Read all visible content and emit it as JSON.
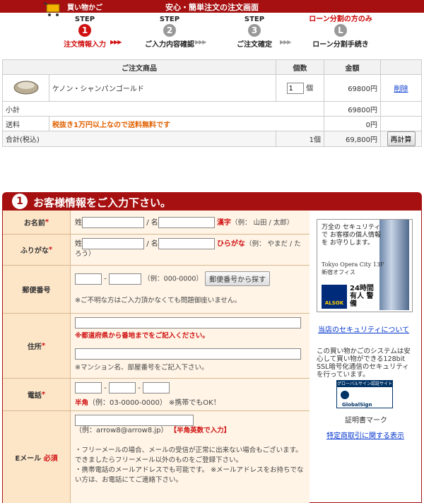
{
  "header": {
    "cart_label": "買い物かご",
    "title": "安心・簡単注文の注文画面"
  },
  "steps": [
    {
      "label": "STEP",
      "num": "1",
      "caption": "注文情報入力"
    },
    {
      "label": "STEP",
      "num": "2",
      "caption": "ご入力内容確認"
    },
    {
      "label": "STEP",
      "num": "3",
      "caption": "ご注文確定"
    },
    {
      "label": "ローン分割の方のみ",
      "num": "L",
      "caption": "ローン分割手続き"
    }
  ],
  "arrow_glyph": "▶▶▶",
  "cart": {
    "headers": [
      "ご注文商品",
      "個数",
      "金額"
    ],
    "item": {
      "name": "ケノン・シャンパンゴールド",
      "qty": "1",
      "qty_unit": "個",
      "price": "69800円",
      "delete": "削除"
    },
    "subtotal_label": "小計",
    "subtotal": "69800円",
    "shipping_label": "送料",
    "shipping_note": "税抜き1万円以上なので送料無料です",
    "shipping": "0円",
    "total_label": "合計(税込)",
    "total_qty": "1個",
    "total": "69,800円",
    "recalc": "再計算"
  },
  "section": {
    "num": "1",
    "title": "お客様情報をご入力下さい。"
  },
  "form": {
    "name": {
      "label": "お名前",
      "req": "*",
      "sei": "姓",
      "sep": "/ 名",
      "kind": "漢字",
      "example": "（例： 山田 / 太郎）"
    },
    "kana": {
      "label": "ふりがな",
      "req": "*",
      "sei": "姓",
      "sep": "/ 名",
      "kind": "ひらがな",
      "example": "（例： やまだ / たろう）"
    },
    "zip": {
      "label": "郵便番号",
      "dash": "-",
      "example": "（例：000-0000）",
      "button": "郵便番号から探す",
      "note": "※ご不明な方はご入力頂かなくても問題御座いません。"
    },
    "address": {
      "label": "住所",
      "req": "*",
      "note1": "※都道府県から番地までをご記入ください。",
      "note2": "※マンション名、部屋番号をご記入下さい。"
    },
    "tel": {
      "label": "電話",
      "req": "*",
      "dash": "-",
      "kind": "半角",
      "example": "（例：03-0000-0000）",
      "note": "※携帯でもOK！"
    },
    "email": {
      "label": "Eメール",
      "req": "必須",
      "example": "（例：arrow8@arrow8.jp）",
      "kind": "【半角英数で入力】",
      "note1": "・フリーメールの場合、メールの受信が正常に出来ない場合もございます。 できましたらフリーメール以外のものをご登録下さい。",
      "note2": "・携帯電話のメールアドレスでも可能です。 ※メールアドレスをお持ちでない方は、お電話にてご連絡下さい。"
    }
  },
  "side": {
    "security_text": "万全の セキュリティで お客様の個人情報を お守りします。",
    "city_line1": "Tokyo Opera City 13F",
    "city_line2": "新宿オフィス",
    "alsok": "ALSOK",
    "guard": "24時間 有人 警備",
    "security_link": "当店のセキュリティについて",
    "ssl_text": "この買い物かごのシステムは安心して買い物ができる128bit SSL暗号化通信のセキュリティを行っています。",
    "gs_bar": "グローバルサイン認証サイト",
    "gs_logo": "GlobalSign",
    "cert_label": "証明書マーク",
    "law_link": "特定商取引に関する表示"
  }
}
